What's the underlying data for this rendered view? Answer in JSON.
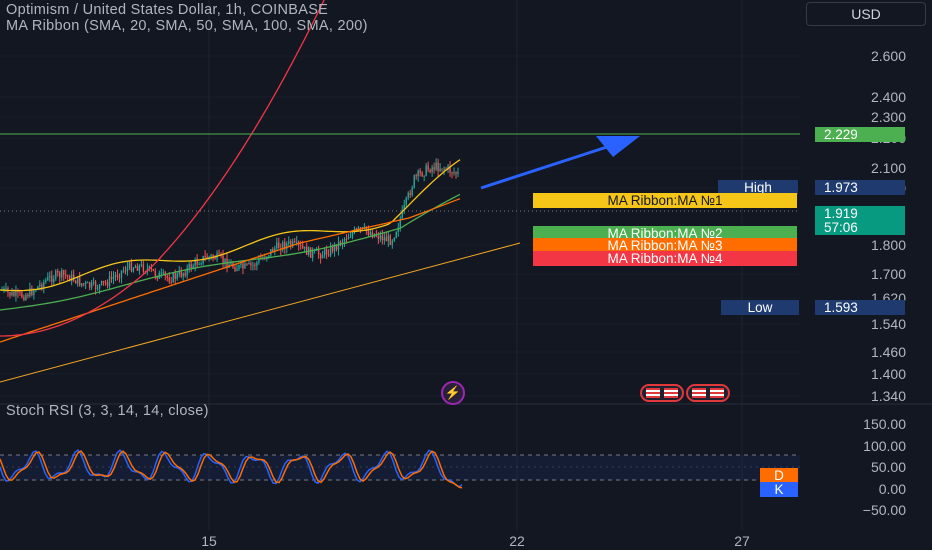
{
  "header": {
    "symbol_title": "Optimism / United States Dollar, 1h, COINBASE",
    "indicator_title": "MA Ribbon (SMA, 20, SMA, 50, SMA, 100, SMA, 200)",
    "currency": "USD"
  },
  "main_axis": {
    "ticks": [
      "2.600",
      "2.400",
      "2.300",
      "2.200",
      "2.100",
      "2.000",
      "1.800",
      "1.700",
      "1.620",
      "1.540",
      "1.460",
      "1.400",
      "1.340"
    ]
  },
  "price_tags": {
    "target": "2.229",
    "current_price": "1.919",
    "countdown": "57:06",
    "high_label": "High",
    "high_value": "1.973",
    "low_label": "Low",
    "low_value": "1.593"
  },
  "ma_labels": [
    {
      "text": "MA Ribbon:MA №1",
      "color": "#f5c518",
      "text_color": "#131722"
    },
    {
      "text": "MA Ribbon:MA №2",
      "color": "#4caf50",
      "text_color": "#ffffff"
    },
    {
      "text": "MA Ribbon:MA №3",
      "color": "#ff6d00",
      "text_color": "#ffffff"
    },
    {
      "text": "MA Ribbon:MA №4",
      "color": "#f23645",
      "text_color": "#ffffff"
    }
  ],
  "stoch": {
    "title": "Stoch RSI (3, 3, 14, 14, close)",
    "ticks": [
      "150.00",
      "100.00",
      "50.00",
      "0.00",
      "−50.00"
    ],
    "d_label": "D",
    "k_label": "K",
    "d_color": "#ff6d00",
    "k_color": "#2962ff"
  },
  "time_axis": {
    "labels": [
      "15",
      "22",
      "27"
    ]
  },
  "colors": {
    "background": "#131722",
    "up": "#26a69a",
    "down": "#ef5350",
    "ma1": "#f5c518",
    "ma2": "#4caf50",
    "ma3": "#ff6d00",
    "ma4": "#f23645",
    "arrow": "#2962ff",
    "target_line": "#4caf50"
  },
  "icons": [
    "lightning-icon",
    "us-flag-icon"
  ]
}
